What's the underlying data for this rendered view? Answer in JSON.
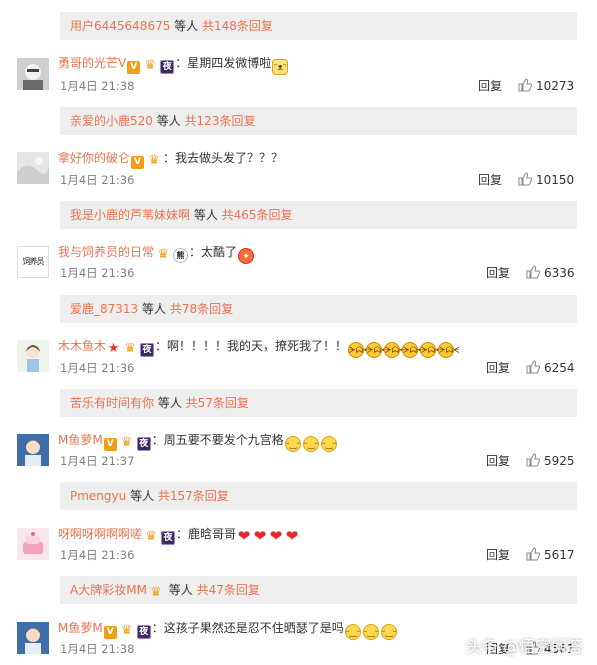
{
  "threads": [
    {
      "reply_bar": {
        "user": "用户6445648675",
        "mid": " 等人 ",
        "count": "共148条回复"
      },
      "comment": {
        "name": "勇哥的光芒V",
        "text": "：星期四发微博啦",
        "time": "1月4日 21:38",
        "reply": "回复",
        "likes": "10273"
      }
    },
    {
      "reply_bar": {
        "user": "亲爱的小鹿520",
        "mid": " 等人 ",
        "count": "共123条回复"
      },
      "comment": {
        "name": "拿好你的破仑",
        "text": "：我去做头发了？？？",
        "time": "1月4日 21:36",
        "reply": "回复",
        "likes": "10150"
      }
    },
    {
      "reply_bar": {
        "user": "我是小鹿的芦苇妹妹啊",
        "mid": " 等人 ",
        "count": "共465条回复"
      },
      "comment": {
        "name": "我与饲养员的日常",
        "text": "：太酷了",
        "time": "1月4日 21:36",
        "reply": "回复",
        "likes": "6336"
      }
    },
    {
      "reply_bar": {
        "user": "爱鹿_87313",
        "mid": " 等人 ",
        "count": "共78条回复"
      },
      "comment": {
        "name": "木木鱼木",
        "text": "：啊！！！！我的天，撩死我了！！",
        "time": "1月4日 21:36",
        "reply": "回复",
        "likes": "6254"
      }
    },
    {
      "reply_bar": {
        "user": "苦乐有时间有你",
        "mid": " 等人 ",
        "count": "共57条回复"
      },
      "comment": {
        "name": "M鱼萝M",
        "text": "：周五要不要发个九宫格",
        "time": "1月4日 21:37",
        "reply": "回复",
        "likes": "5925"
      }
    },
    {
      "reply_bar": {
        "user": "Pmengyu",
        "mid": " 等人 ",
        "count": "共157条回复"
      },
      "comment": {
        "name": "呀啊呀啊啊啊嗟",
        "text": "：鹿晗哥哥",
        "time": "1月4日 21:36",
        "reply": "回复",
        "likes": "5617"
      }
    },
    {
      "reply_bar": {
        "user": "A大牌彩妆MM",
        "mid": " 等人 ",
        "count": "共47条回复"
      },
      "comment": {
        "name": "M鱼萝M",
        "text": "：这孩子果然还是忍不住晒瑟了是吗",
        "time": "1月4日 21:38",
        "reply": "回复",
        "likes": "4561"
      }
    }
  ],
  "badges": {
    "v": "V",
    "night": "夜",
    "star": "★",
    "crown": "♛",
    "panda": "熊"
  },
  "avatar_text": {
    "feeder": "饲养员"
  },
  "watermark": "头条 @悟空问答",
  "colors": {
    "accent": "#eb7350",
    "bar_bg": "#eeeeee",
    "muted": "#808080"
  }
}
